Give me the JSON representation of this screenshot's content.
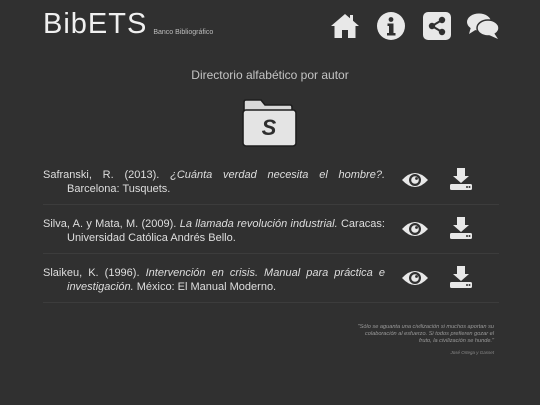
{
  "header": {
    "logo": "BibETS",
    "subtitle": "Banco Bibliográfico",
    "nav": [
      {
        "icon": "home-icon"
      },
      {
        "icon": "info-icon"
      },
      {
        "icon": "share-icon"
      },
      {
        "icon": "chat-icon"
      }
    ]
  },
  "main": {
    "title": "Directorio alfabético por autor",
    "folder_letter": "S"
  },
  "references": [
    {
      "authors": "Safranski, R. (2013).",
      "title": "¿Cuánta verdad necesita el hombre?.",
      "publisher": "Barcelona: Tusquets."
    },
    {
      "authors": "Silva, A. y Mata, M. (2009).",
      "title": "La llamada revolución industrial.",
      "publisher": "Caracas: Universidad Católica Andrés Bello."
    },
    {
      "authors": "Slaikeu, K. (1996).",
      "title": "Intervención en crisis. Manual para práctica e investigación.",
      "publisher": "México: El Manual Moderno."
    }
  ],
  "quote": {
    "text": "\"Sólo se aguanta una civilización si muchos aportan su colaboración al esfuerzo. Si todos prefieren gozar el fruto, la civilización se hunde.\"",
    "author": "José Ortega y Gasset"
  },
  "colors": {
    "background": "#303030",
    "icon": "#e8e8e8",
    "text": "#dedede"
  }
}
